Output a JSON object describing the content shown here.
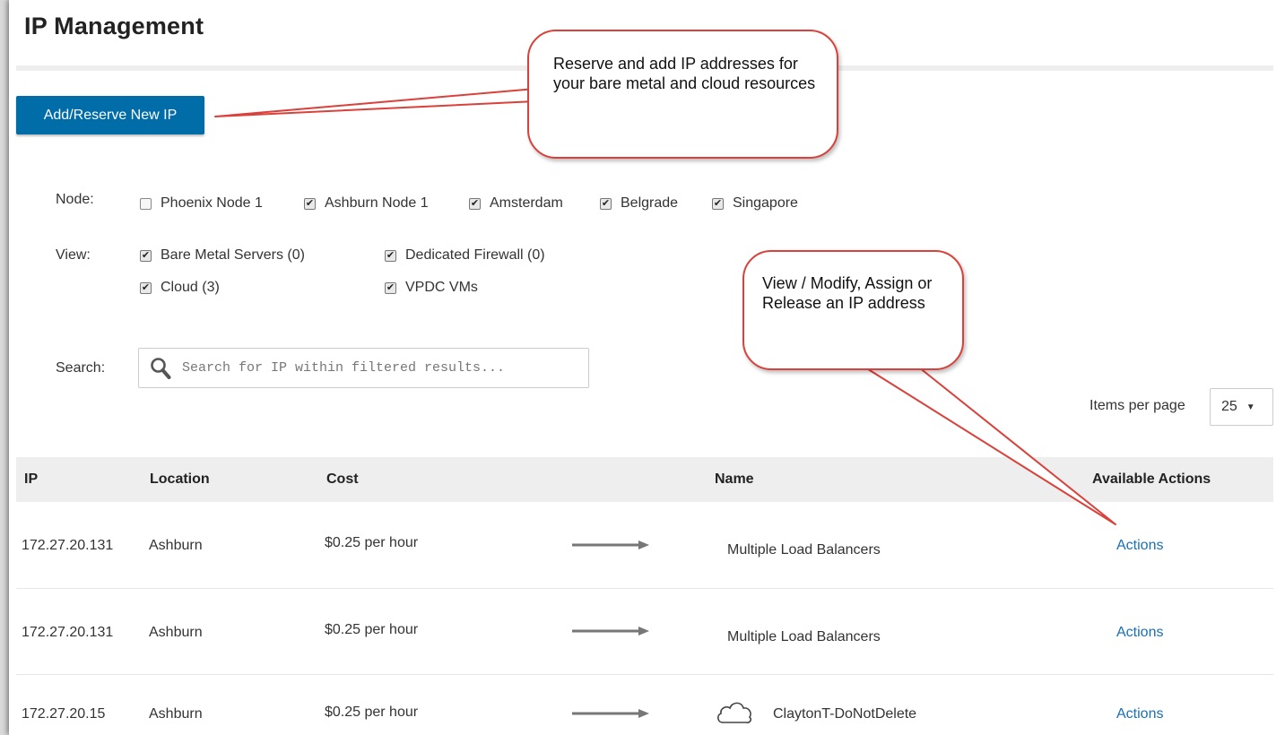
{
  "page": {
    "title": "IP Management"
  },
  "toolbar": {
    "add_button_label": "Add/Reserve New IP"
  },
  "filters": {
    "node_label": "Node:",
    "nodes": [
      {
        "label": "Phoenix Node 1",
        "checked": false
      },
      {
        "label": "Ashburn Node 1",
        "checked": true
      },
      {
        "label": "Amsterdam",
        "checked": true
      },
      {
        "label": "Belgrade",
        "checked": true
      },
      {
        "label": "Singapore",
        "checked": true
      }
    ],
    "view_label": "View:",
    "views": [
      {
        "label": "Bare Metal Servers (0)",
        "checked": true
      },
      {
        "label": "Dedicated Firewall (0)",
        "checked": true
      },
      {
        "label": "Cloud (3)",
        "checked": true
      },
      {
        "label": "VPDC VMs",
        "checked": true
      }
    ],
    "search_label": "Search:",
    "search_placeholder": "Search for IP within filtered results..."
  },
  "pagination": {
    "items_per_page_label": "Items per page",
    "items_per_page_value": "25"
  },
  "table": {
    "headers": {
      "ip": "IP",
      "location": "Location",
      "cost": "Cost",
      "name": "Name",
      "actions": "Available Actions"
    },
    "rows": [
      {
        "ip": "172.27.20.131",
        "location": "Ashburn",
        "cost": "$0.25 per hour",
        "name": "Multiple Load Balancers",
        "icon": "",
        "action": "Actions"
      },
      {
        "ip": "172.27.20.131",
        "location": "Ashburn",
        "cost": "$0.25 per hour",
        "name": "Multiple Load Balancers",
        "icon": "",
        "action": "Actions"
      },
      {
        "ip": "172.27.20.15",
        "location": "Ashburn",
        "cost": "$0.25 per hour",
        "name": "ClaytonT-DoNotDelete",
        "icon": "cloud-icon",
        "action": "Actions"
      }
    ]
  },
  "callouts": {
    "reserve": "Reserve and add IP addresses for your bare metal and cloud resources",
    "actions": "View / Modify, Assign or Release an IP address"
  },
  "colors": {
    "primary_button": "#006ca8",
    "link": "#1a6fb5",
    "callout_border": "#d9413a",
    "header_bg": "#eeeeee"
  }
}
